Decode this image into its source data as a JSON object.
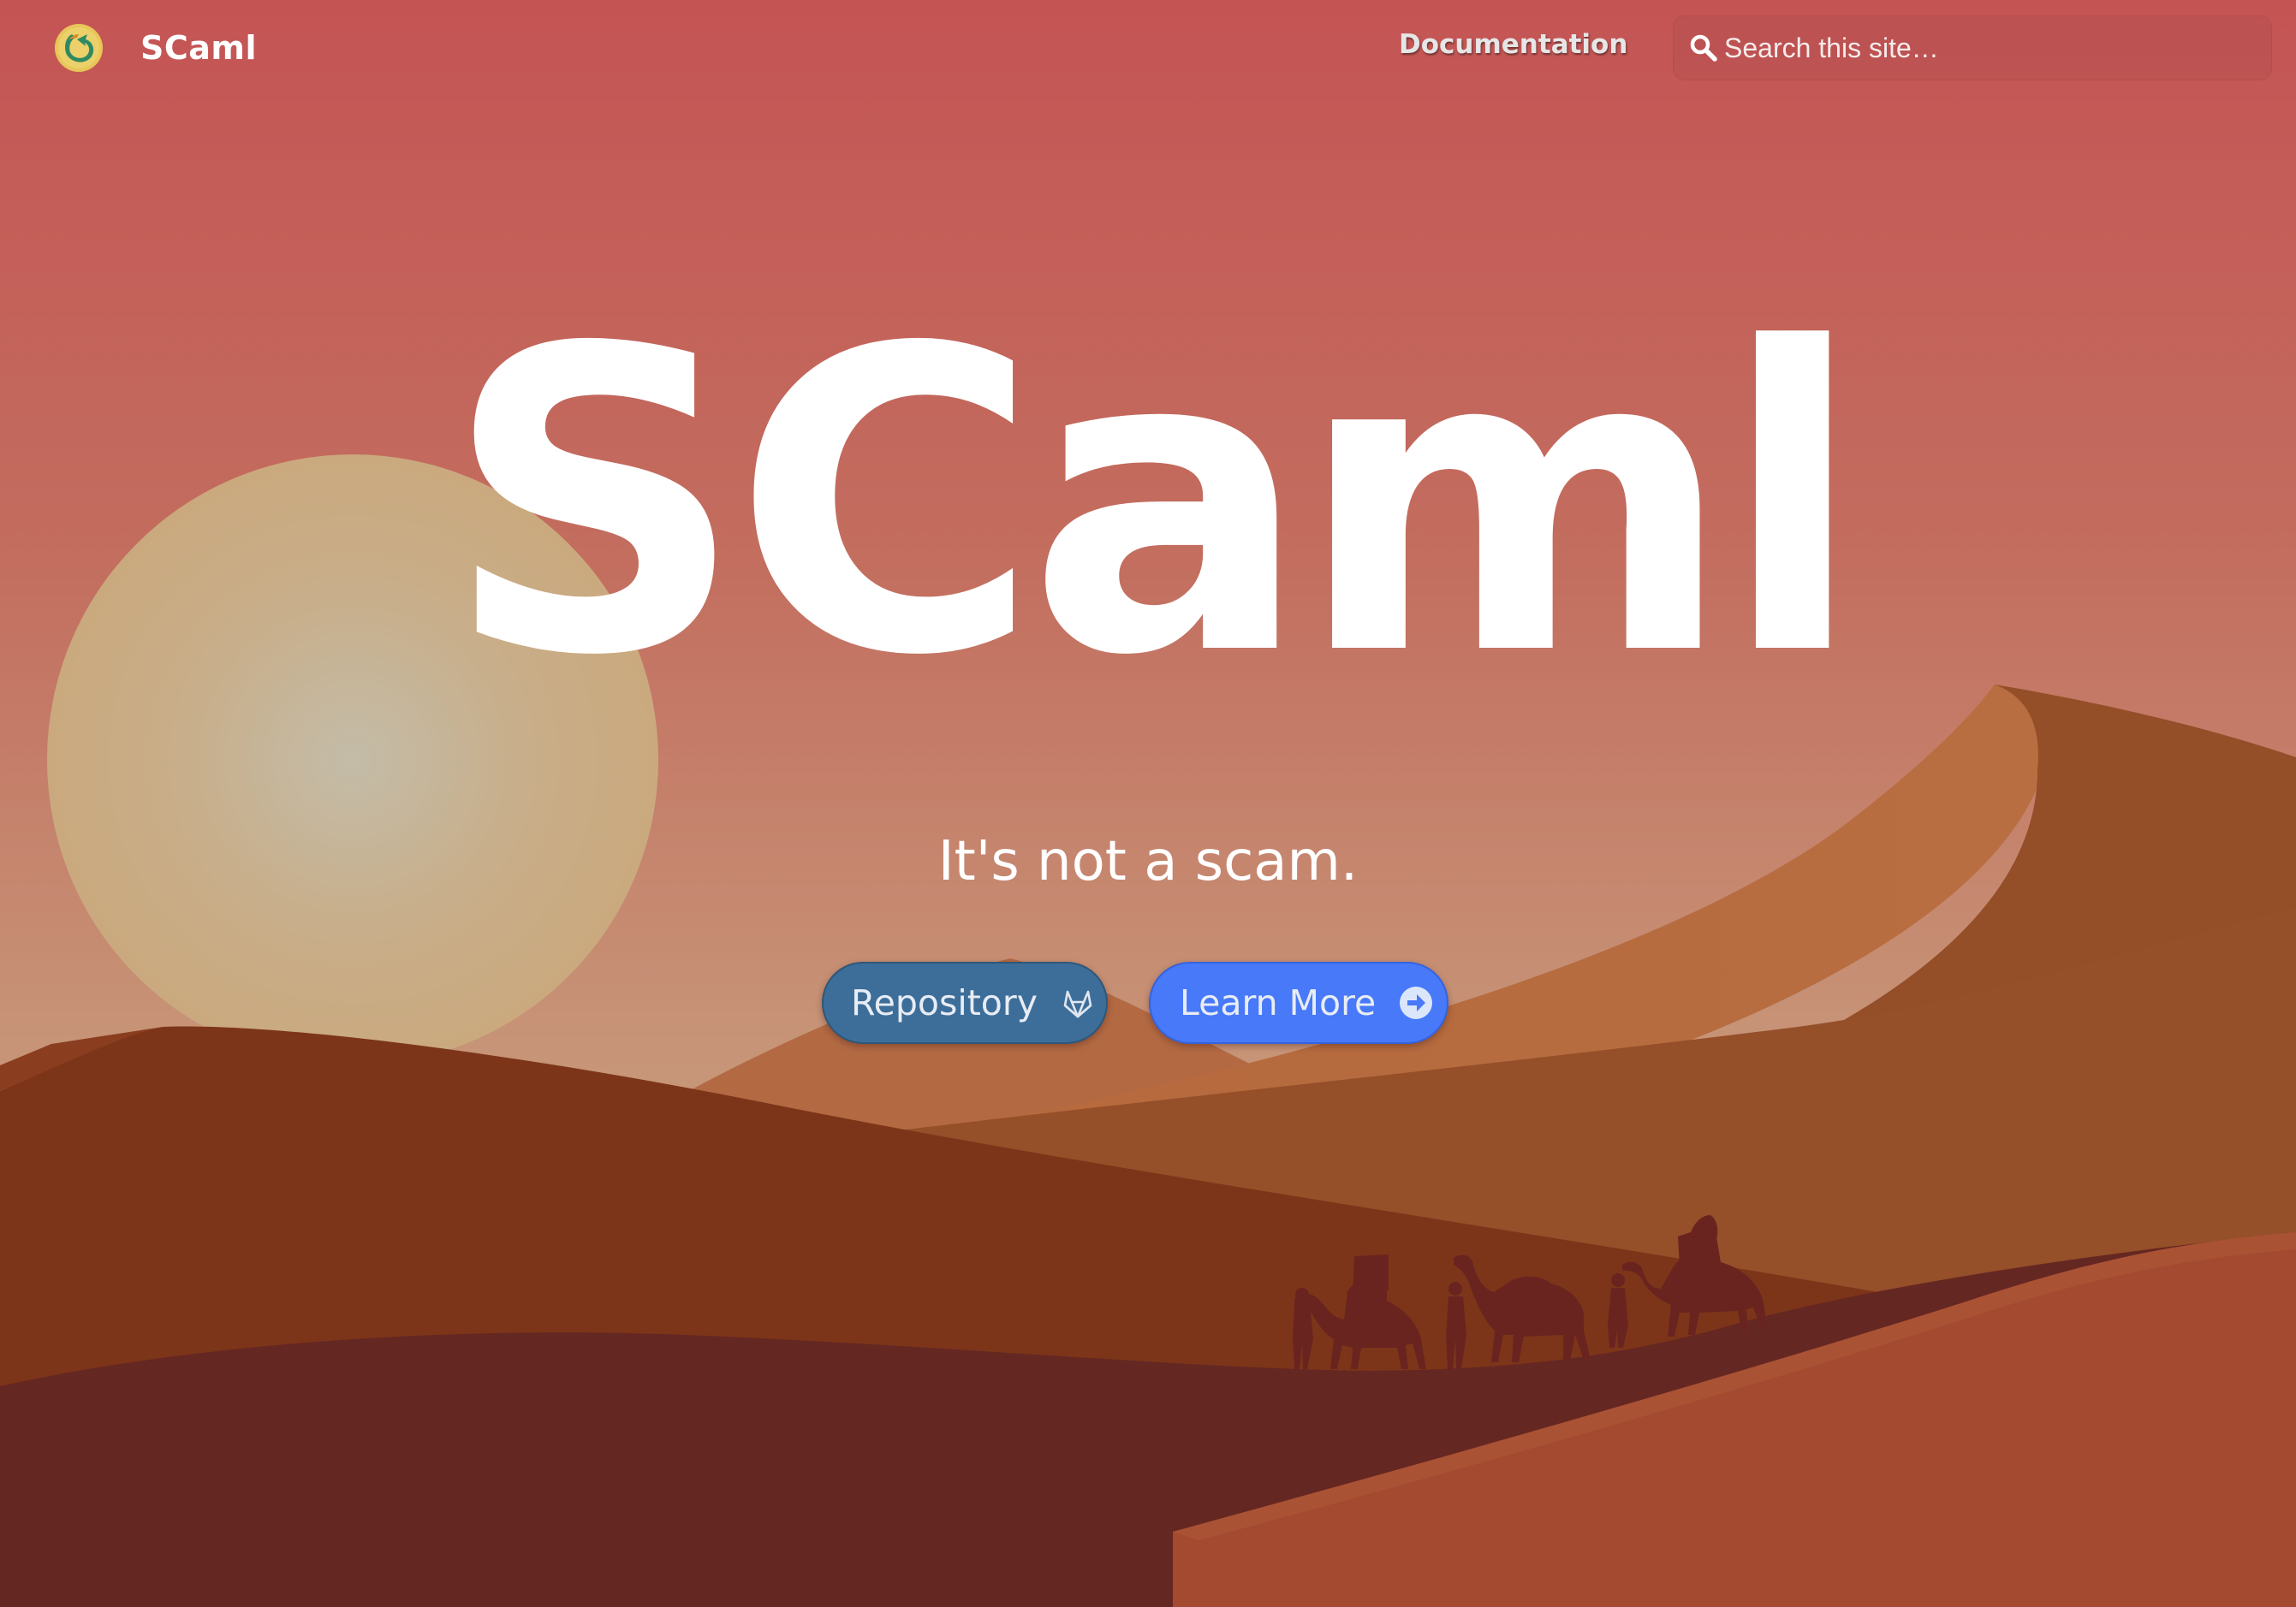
{
  "colors": {
    "sky_top": "#c45454",
    "sky_bottom": "#c9a284",
    "sun": "#cdb08a",
    "repo_button": "#3d6e9a",
    "learn_button": "#4779f8",
    "text": "#ffffff"
  },
  "nav": {
    "brand_name": "SCaml",
    "brand_icon": "scaml-logo-icon",
    "links": [
      {
        "label": "Documentation"
      }
    ],
    "search": {
      "placeholder": "Search this site…",
      "icon": "search-icon"
    }
  },
  "hero": {
    "title": "SCaml",
    "subtitle": "It's not a scam.",
    "buttons": [
      {
        "label": "Repository",
        "icon": "gitlab-icon"
      },
      {
        "label": "Learn More",
        "icon": "arrow-circle-right-icon"
      }
    ]
  }
}
